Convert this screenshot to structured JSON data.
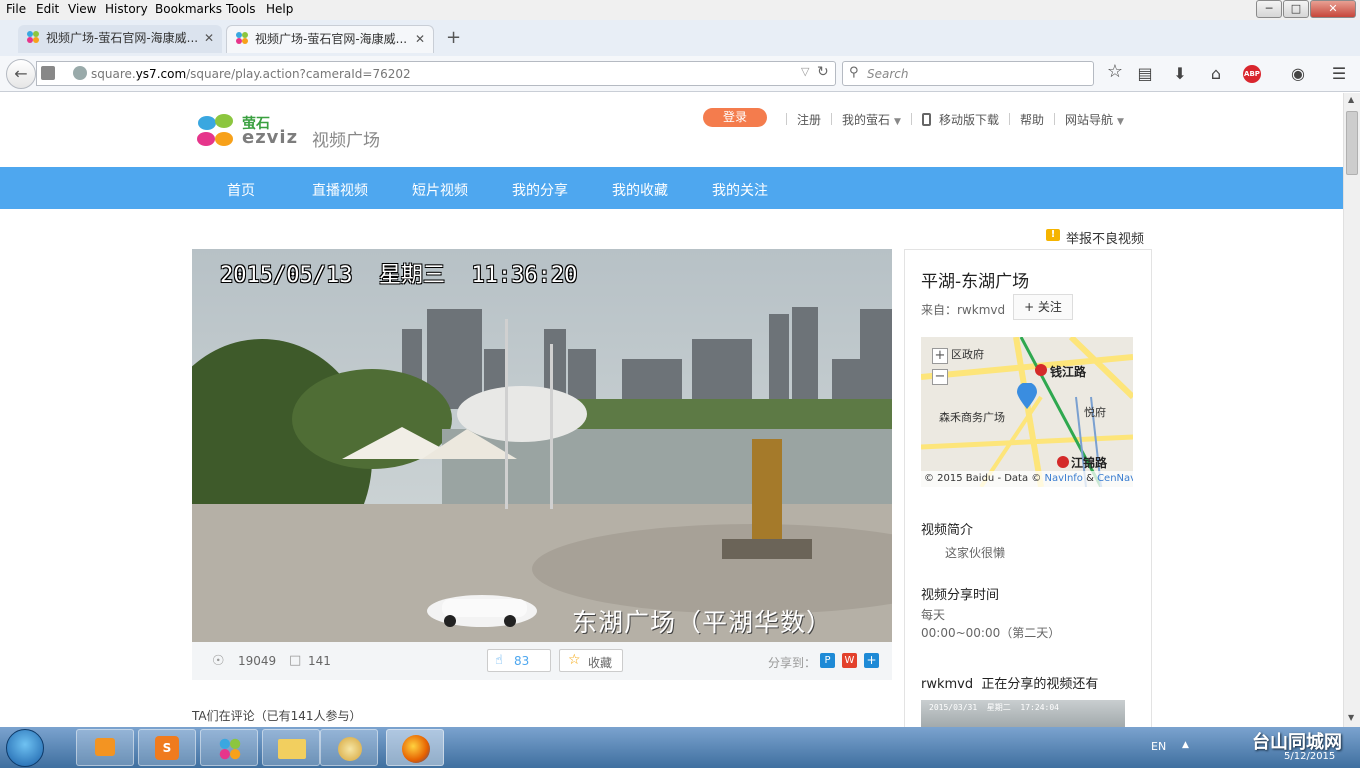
{
  "menu": {
    "file": "File",
    "edit": "Edit",
    "view": "View",
    "history": "History",
    "bookmarks": "Bookmarks",
    "tools": "Tools",
    "help": "Help"
  },
  "tabs": [
    {
      "title": "视频广场-萤石官网-海康威..."
    },
    {
      "title": "视频广场-萤石官网-海康威..."
    }
  ],
  "new_tab": "+",
  "url": {
    "prefix": "square.",
    "domain": "ys7.com",
    "path": "/square/play.action?cameraId=76202"
  },
  "search": {
    "placeholder": "Search"
  },
  "site": {
    "logo_cn": "萤石",
    "logo_en": "EZVIZ",
    "logo_sub": "视频广场",
    "login": "登录",
    "register": "注册",
    "my": "我的萤石",
    "mobile": "移动版下载",
    "help": "帮助",
    "sitenav": "网站导航",
    "nav": [
      "首页",
      "直播视频",
      "短片视频",
      "我的分享",
      "我的收藏",
      "我的关注"
    ],
    "report": "举报不良视频"
  },
  "video": {
    "osd_datetime": "2015/05/13  星期三  11:36:20",
    "osd_location": "东湖广场（平湖华数）",
    "views": "19049",
    "comments": "141",
    "likes": "83",
    "favorite": "收藏",
    "share_label": "分享到：",
    "comment_title": "TA们在评论（已有141人参与）"
  },
  "side": {
    "title": "平湖-东湖广场",
    "from_label": "来自：rwkmvd",
    "follow": "+ 关注",
    "map_labels": {
      "gov": "区政府",
      "qianjiang": "钱江路",
      "senhe": "森禾商务广场",
      "yuefu": "悦府",
      "jiangjin": "江锦路",
      "credit_main": "© 2015 Baidu - Data ©",
      "credit_navinfo": "NavInfo",
      "credit_amp": " & ",
      "credit_cennavi": "CenNavi &"
    },
    "intro_title": "视频简介",
    "intro_text": "这家伙很懒",
    "share_time_title": "视频分享时间",
    "share_time_freq": "每天",
    "share_time_range": "00:00~00:00（第二天）",
    "more_title": "rwkmvd  正在分享的视频还有",
    "thumb_osd": "2015/03/31  星期二  17:24:04"
  },
  "taskbar": {
    "lang": "EN",
    "date": "5/12/2015",
    "watermark": "台山同城网"
  },
  "colors": {
    "brand_blue": "#4ea7ef",
    "login_orange": "#f47c4d",
    "share_blue": "#1e8ad6"
  }
}
